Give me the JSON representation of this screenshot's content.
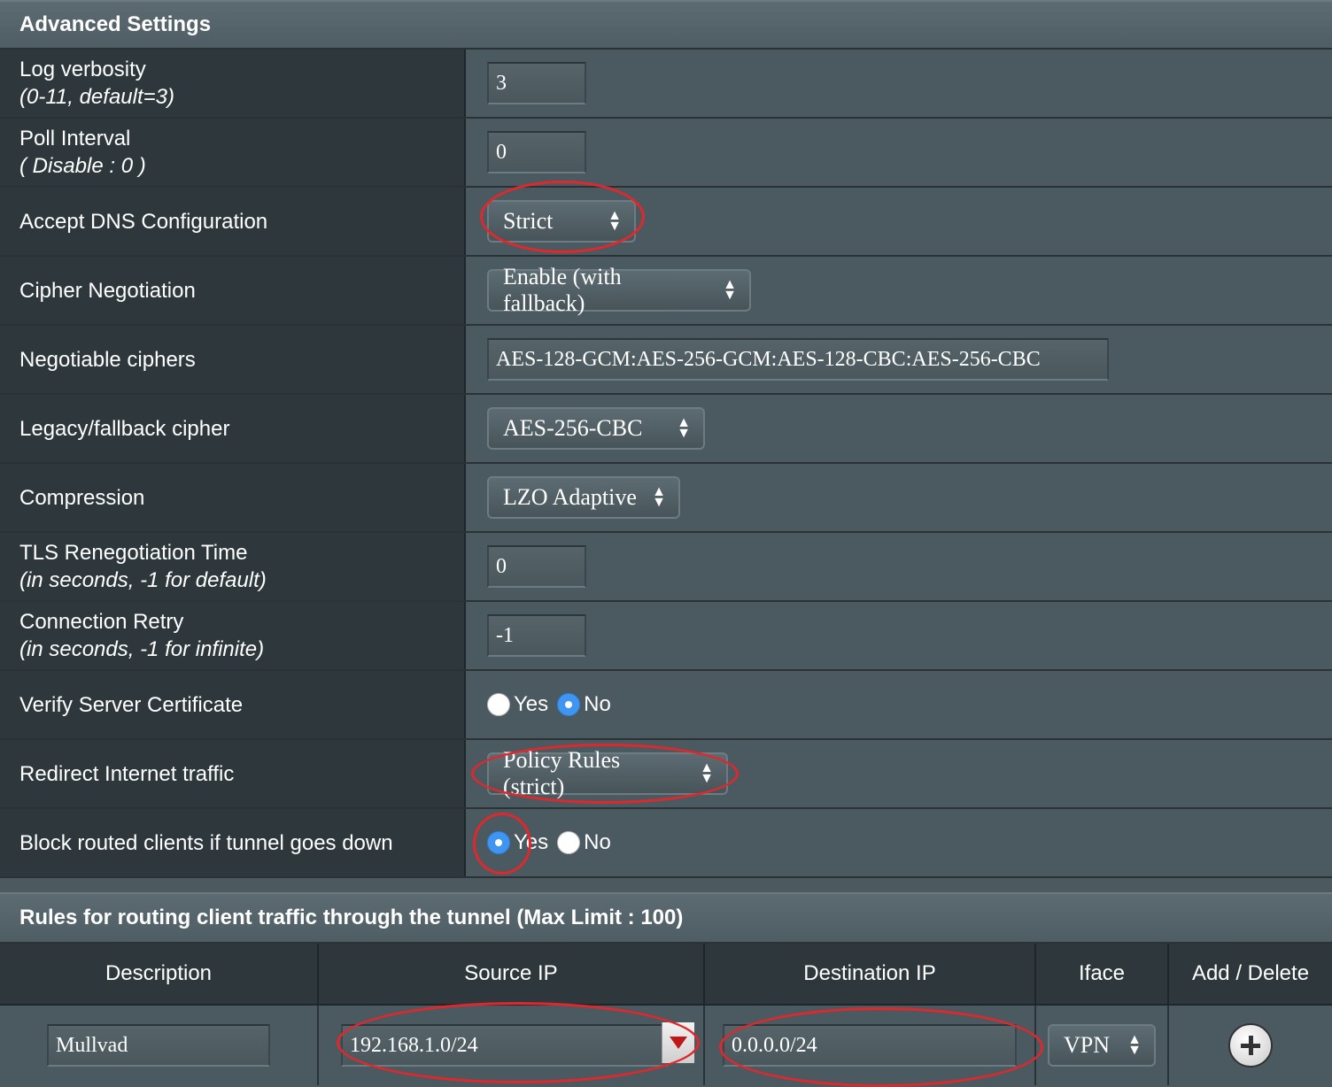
{
  "advanced_settings": {
    "title": "Advanced Settings",
    "log_verbosity": {
      "label": "Log verbosity",
      "hint": "(0-11, default=3)",
      "value": "3"
    },
    "poll_interval": {
      "label": "Poll Interval",
      "hint": "( Disable : 0 )",
      "value": "0"
    },
    "accept_dns": {
      "label": "Accept DNS Configuration",
      "value": "Strict"
    },
    "cipher_negotiation": {
      "label": "Cipher Negotiation",
      "value": "Enable (with fallback)"
    },
    "negotiable_ciphers": {
      "label": "Negotiable ciphers",
      "value": "AES-128-GCM:AES-256-GCM:AES-128-CBC:AES-256-CBC"
    },
    "legacy_cipher": {
      "label": "Legacy/fallback cipher",
      "value": "AES-256-CBC"
    },
    "compression": {
      "label": "Compression",
      "value": "LZO Adaptive"
    },
    "tls_renegotiation": {
      "label": "TLS Renegotiation Time",
      "hint": "(in seconds, -1 for default)",
      "value": "0"
    },
    "connection_retry": {
      "label": "Connection Retry",
      "hint": "(in seconds, -1 for infinite)",
      "value": "-1"
    },
    "verify_server_cert": {
      "label": "Verify Server Certificate",
      "yes": "Yes",
      "no": "No",
      "selected": "No"
    },
    "redirect_traffic": {
      "label": "Redirect Internet traffic",
      "value": "Policy Rules (strict)"
    },
    "block_routed": {
      "label": "Block routed clients if tunnel goes down",
      "yes": "Yes",
      "no": "No",
      "selected": "Yes"
    }
  },
  "rules": {
    "title": "Rules for routing client traffic through the tunnel (Max Limit : 100)",
    "columns": [
      "Description",
      "Source IP",
      "Destination IP",
      "Iface",
      "Add / Delete"
    ],
    "row": {
      "description": "Mullvad",
      "source_ip": "192.168.1.0/24",
      "destination_ip": "0.0.0.0/24",
      "iface": "VPN"
    }
  },
  "colors": {
    "annotation": "#e0282c",
    "radio_selected": "#3e95f2",
    "label_bg": "#2e383c",
    "value_bg": "#4b5960"
  }
}
